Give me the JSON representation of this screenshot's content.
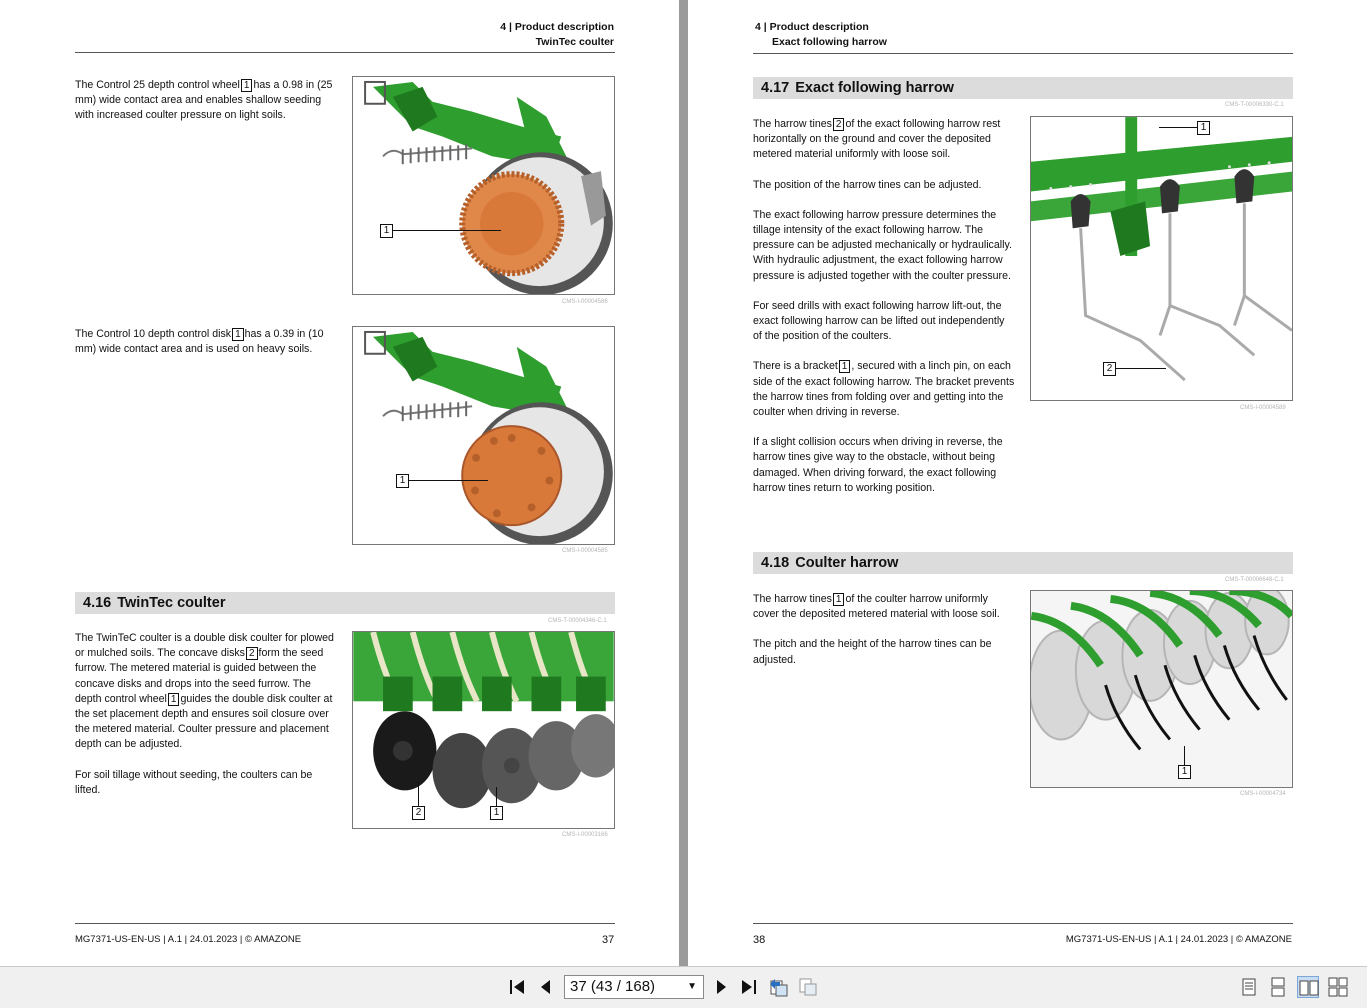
{
  "left_page": {
    "header": {
      "chapter": "4 | Product description",
      "section": "TwinTec coulter"
    },
    "para1": {
      "pre": "The Control 25 depth control wheel",
      "callout": "1",
      "post": "has a 0.98 in (25 mm) wide contact area and enables shallow seeding with increased coulter pressure on light soils."
    },
    "fig1": {
      "label": "1",
      "caption": "CMS-I-00004586"
    },
    "para2": {
      "pre": "The Control 10 depth control disk",
      "callout": "1",
      "post": "has a 0.39 in (10 mm) wide contact area and is used on heavy soils."
    },
    "fig2": {
      "label": "1",
      "caption": "CMS-I-00004585"
    },
    "section": {
      "number": "4.16",
      "title": "TwinTec coulter",
      "ref": "CMS-T-00004346-C.1"
    },
    "para3": {
      "a": "The TwinTeC coulter is a double disk coulter for plowed or mulched soils. The concave disks",
      "c1": "2",
      "b": "form the seed furrow. The metered material is guided between the concave disks and drops into the seed furrow. The depth control wheel",
      "c2": "1",
      "d": "guides the double disk coulter at the set placement depth and ensures soil closure over the metered material. Coulter pressure and placement depth can be adjusted."
    },
    "para4": "For soil tillage without seeding, the coulters can be lifted.",
    "fig3": {
      "label1": "2",
      "label2": "1",
      "caption": "CMS-I-00003166"
    },
    "footer": {
      "doc": "MG7371-US-EN-US | A.1 | 24.01.2023 | © AMAZONE",
      "page": "37"
    }
  },
  "right_page": {
    "header": {
      "chapter": "4 | Product description",
      "section": "Exact following harrow"
    },
    "section1": {
      "number": "4.17",
      "title": "Exact following harrow",
      "ref": "CMS-T-00006330-C.1"
    },
    "p1": {
      "pre": "The harrow tines",
      "callout": "2",
      "post": "of the exact following harrow rest horizontally on the ground and cover the deposited metered material uniformly with loose soil."
    },
    "p2": "The position of the harrow tines can be adjusted.",
    "p3": "The exact following harrow pressure determines the tillage intensity of the exact following harrow. The pressure can be adjusted mechanically or hydraulically. With hydraulic adjustment, the exact following harrow pressure is adjusted together with the coulter pressure.",
    "p4": "For seed drills with exact following harrow lift-out, the exact following harrow can be lifted out independently of the position of the coulters.",
    "p5": {
      "pre": "There is a bracket",
      "callout": "1",
      "post": ", secured with a linch pin, on each side of the exact following harrow. The bracket prevents the harrow tines from folding over and getting into the coulter when driving in reverse."
    },
    "p6": "If a slight collision occurs when driving in reverse, the harrow tines give way to the obstacle, without being damaged. When driving forward, the exact following harrow tines return to working position.",
    "fig4": {
      "label1": "1",
      "label2": "2",
      "caption": "CMS-I-00004589"
    },
    "section2": {
      "number": "4.18",
      "title": "Coulter harrow",
      "ref": "CMS-T-00006648-C.1"
    },
    "p7": {
      "pre": "The harrow tines",
      "callout": "1",
      "post": "of the coulter harrow uniformly cover the deposited metered material with loose soil."
    },
    "p8": "The pitch and the height of the harrow tines can be adjusted.",
    "fig5": {
      "label": "1",
      "caption": "CMS-I-00004734"
    },
    "footer": {
      "doc": "MG7371-US-EN-US | A.1 | 24.01.2023 | © AMAZONE",
      "page": "38"
    }
  },
  "toolbar": {
    "page_indicator": "37 (43 / 168)",
    "buttons": [
      "first-page-icon",
      "previous-page-icon",
      "next-page-icon",
      "last-page-icon",
      "previous-view-icon",
      "next-view-icon",
      "single-page-icon",
      "continuous-page-icon",
      "facing-pages-icon",
      "continuous-facing-icon"
    ]
  },
  "colors": {
    "green": "#2e9e2e",
    "dark_green": "#1f7a1f",
    "orange": "#d8793a",
    "section_bar": "#dcdcdc"
  }
}
